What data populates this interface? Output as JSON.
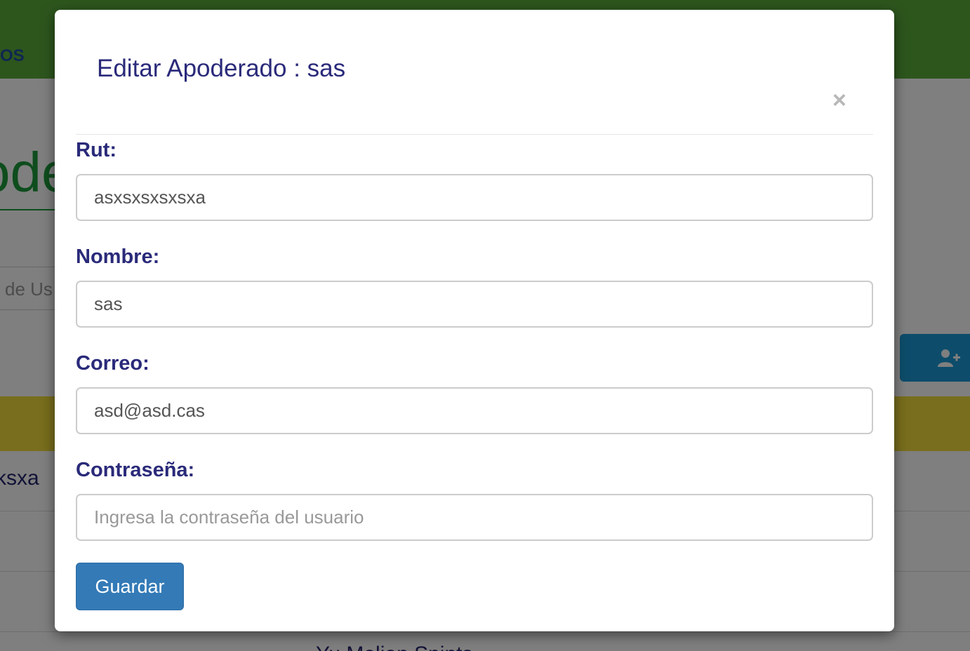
{
  "background": {
    "nav_link": "OS",
    "heading": "ode",
    "search_placeholder": "de Us",
    "table_row_text": "ĸsxa",
    "bottom_text": "Yu   Malian Spints"
  },
  "modal": {
    "title": "Editar Apoderado : sas",
    "close_glyph": "×",
    "fields": [
      {
        "label": "Rut:",
        "value": "asxsxsxsxsxa",
        "placeholder": ""
      },
      {
        "label": "Nombre:",
        "value": "sas",
        "placeholder": ""
      },
      {
        "label": "Correo:",
        "value": "asd@asd.cas",
        "placeholder": ""
      },
      {
        "label": "Contraseña:",
        "value": "",
        "placeholder": "Ingresa la contraseña del usuario"
      }
    ],
    "save_label": "Guardar"
  },
  "colors": {
    "navbar": "#5aad3a",
    "title_text": "#2a2a7a",
    "primary_button": "#337ab7",
    "add_button": "#1a9bd7",
    "table_header": "#f0dd3a"
  },
  "icons": {
    "close": "close-icon",
    "add_user": "user-plus-icon"
  }
}
